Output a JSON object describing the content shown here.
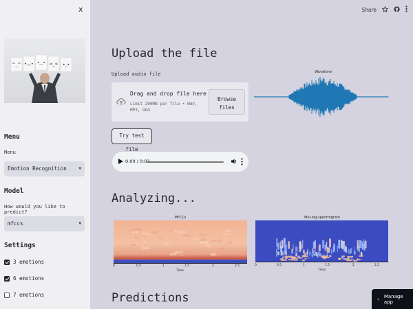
{
  "sidebar": {
    "close_label": "x",
    "menu_heading": "Menu",
    "menu_label": "Menu",
    "menu_value": "Emotion Recognition",
    "model_heading": "Model",
    "model_label": "How would you like to predict?",
    "model_value": "mfccs",
    "settings_heading": "Settings",
    "settings": [
      {
        "label": "3 emotions",
        "checked": true
      },
      {
        "label": "6 emotions",
        "checked": true
      },
      {
        "label": "7 emotions",
        "checked": false
      }
    ],
    "faces": [
      "^_^",
      "•︵•",
      "•‿•",
      "⊙_⊙",
      ">_<",
      "•_•"
    ]
  },
  "topbar": {
    "share_label": "Share"
  },
  "main": {
    "upload_heading": "Upload the file",
    "upload_label": "Upload audio file",
    "dropzone_title": "Drag and drop file here",
    "dropzone_subtitle": "Limit 200MB per file • WAV, MP3, OGG",
    "browse_label_1": "Browse",
    "browse_label_2": "files",
    "try_button": "Try test file",
    "audio_time": "0:00 / 0:02",
    "waveform_title": "Waveform",
    "analyzing_heading": "Analyzing...",
    "predictions_heading": "Predictions",
    "manage_app": "Manage app"
  },
  "chart_data": [
    {
      "type": "heatmap",
      "title": "MFCCs",
      "xlabel": "Time",
      "xticks": [
        "0",
        "0.5",
        "1",
        "1.5",
        "2",
        "2.5"
      ],
      "colormap": "coolwarm"
    },
    {
      "type": "heatmap",
      "title": "Mel-log-spectrogram",
      "xlabel": "Time",
      "xticks": [
        "0",
        "0.5",
        "1",
        "1.5",
        "2",
        "2.5"
      ],
      "colormap": "coolwarm"
    }
  ],
  "colors": {
    "sidebar_bg": "#f0f0f3",
    "main_bg": "#d4d3df",
    "waveform": "#1f77b4",
    "mfcc_warm": "#f4b79a",
    "spec_cool": "#3b4cc0"
  }
}
